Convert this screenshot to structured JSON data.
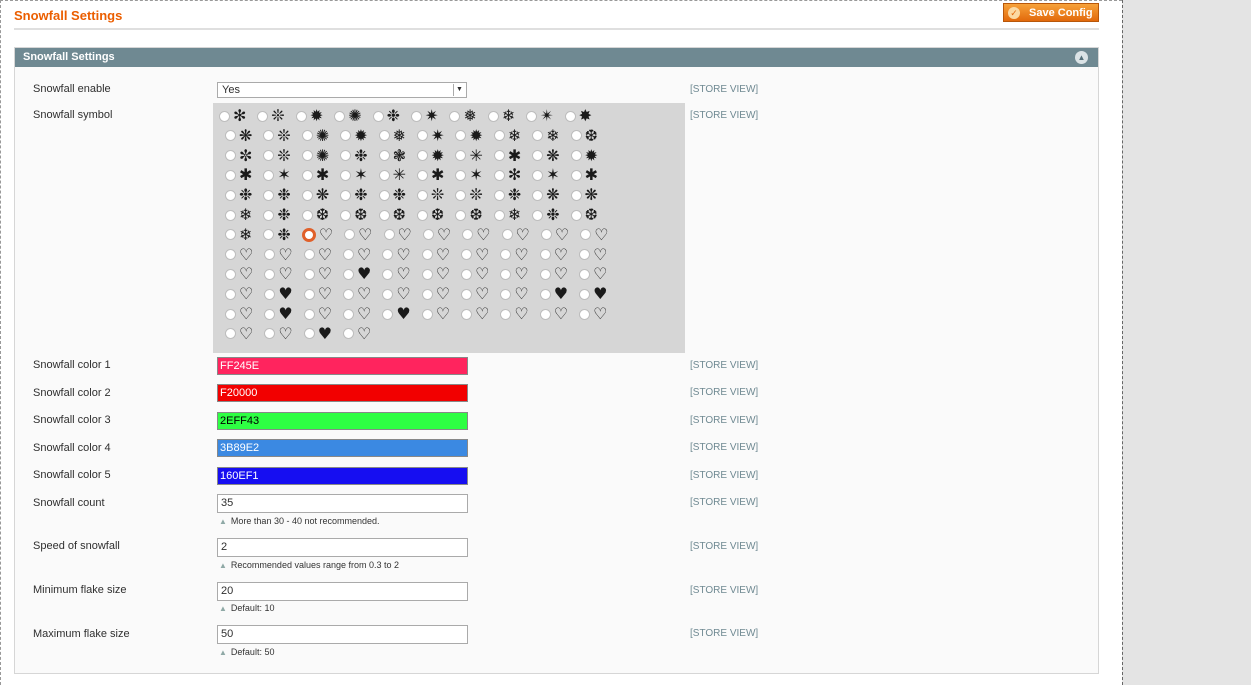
{
  "page": {
    "title": "Snowfall Settings",
    "save_label": "Save Config"
  },
  "section": {
    "title": "Snowfall Settings"
  },
  "scope_label": "[STORE VIEW]",
  "fields": {
    "enable": {
      "label": "Snowfall enable",
      "value": "Yes"
    },
    "symbol": {
      "label": "Snowfall symbol",
      "selected_row": 6,
      "selected_col": 2
    },
    "color1": {
      "label": "Snowfall color 1",
      "value": "FF245E",
      "bg": "#FF245E",
      "fg": "#ffffff"
    },
    "color2": {
      "label": "Snowfall color 2",
      "value": "F20000",
      "bg": "#F20000",
      "fg": "#ffffff"
    },
    "color3": {
      "label": "Snowfall color 3",
      "value": "2EFF43",
      "bg": "#2EFF43",
      "fg": "#000000"
    },
    "color4": {
      "label": "Snowfall color 4",
      "value": "3B89E2",
      "bg": "#3B89E2",
      "fg": "#ffffff"
    },
    "color5": {
      "label": "Snowfall color 5",
      "value": "160EF1",
      "bg": "#160EF1",
      "fg": "#ffffff"
    },
    "count": {
      "label": "Snowfall count",
      "value": "35",
      "note": "More than 30 - 40 not recommended."
    },
    "speed": {
      "label": "Speed of snowfall",
      "value": "2",
      "note": "Recommended values range from 0.3 to 2"
    },
    "min_size": {
      "label": "Minimum flake size",
      "value": "20",
      "note": "Default: 10"
    },
    "max_size": {
      "label": "Maximum flake size",
      "value": "50",
      "note": "Default: 50"
    }
  },
  "symbol_rows": [
    [
      "✻",
      "❊",
      "✹",
      "✺",
      "❉",
      "✷",
      "❅",
      "❄",
      "✴",
      "✸"
    ],
    [
      "❋",
      "❊",
      "✺",
      "✹",
      "❅",
      "✷",
      "✹",
      "❄",
      "❄",
      "❆"
    ],
    [
      "✼",
      "❊",
      "✺",
      "❉",
      "❃",
      "✹",
      "✳",
      "✱",
      "❋",
      "✹"
    ],
    [
      "✱",
      "✶",
      "✱",
      "✶",
      "✳",
      "✱",
      "✶",
      "✻",
      "✶",
      "✱"
    ],
    [
      "❉",
      "❉",
      "❋",
      "❉",
      "❉",
      "❊",
      "❊",
      "❉",
      "❋",
      "❋"
    ],
    [
      "❄",
      "❉",
      "❆",
      "❆",
      "❆",
      "❆",
      "❆",
      "❄",
      "❉",
      "❆"
    ],
    [
      "❄",
      "❉",
      "♡",
      "♡",
      "♡",
      "♡",
      "♡",
      "♡",
      "♡",
      "♡"
    ],
    [
      "♡",
      "♡",
      "♡",
      "♡",
      "♡",
      "♡",
      "♡",
      "♡",
      "♡",
      "♡"
    ],
    [
      "♡",
      "♡",
      "♡",
      "♥",
      "♡",
      "♡",
      "♡",
      "♡",
      "♡",
      "♡"
    ],
    [
      "♡",
      "♥",
      "♡",
      "♡",
      "♡",
      "♡",
      "♡",
      "♡",
      "♥",
      "♥"
    ],
    [
      "♡",
      "♥",
      "♡",
      "♡",
      "♥",
      "♡",
      "♡",
      "♡",
      "♡",
      "♡"
    ],
    [
      "♡",
      "♡",
      "♥",
      "♡"
    ]
  ]
}
